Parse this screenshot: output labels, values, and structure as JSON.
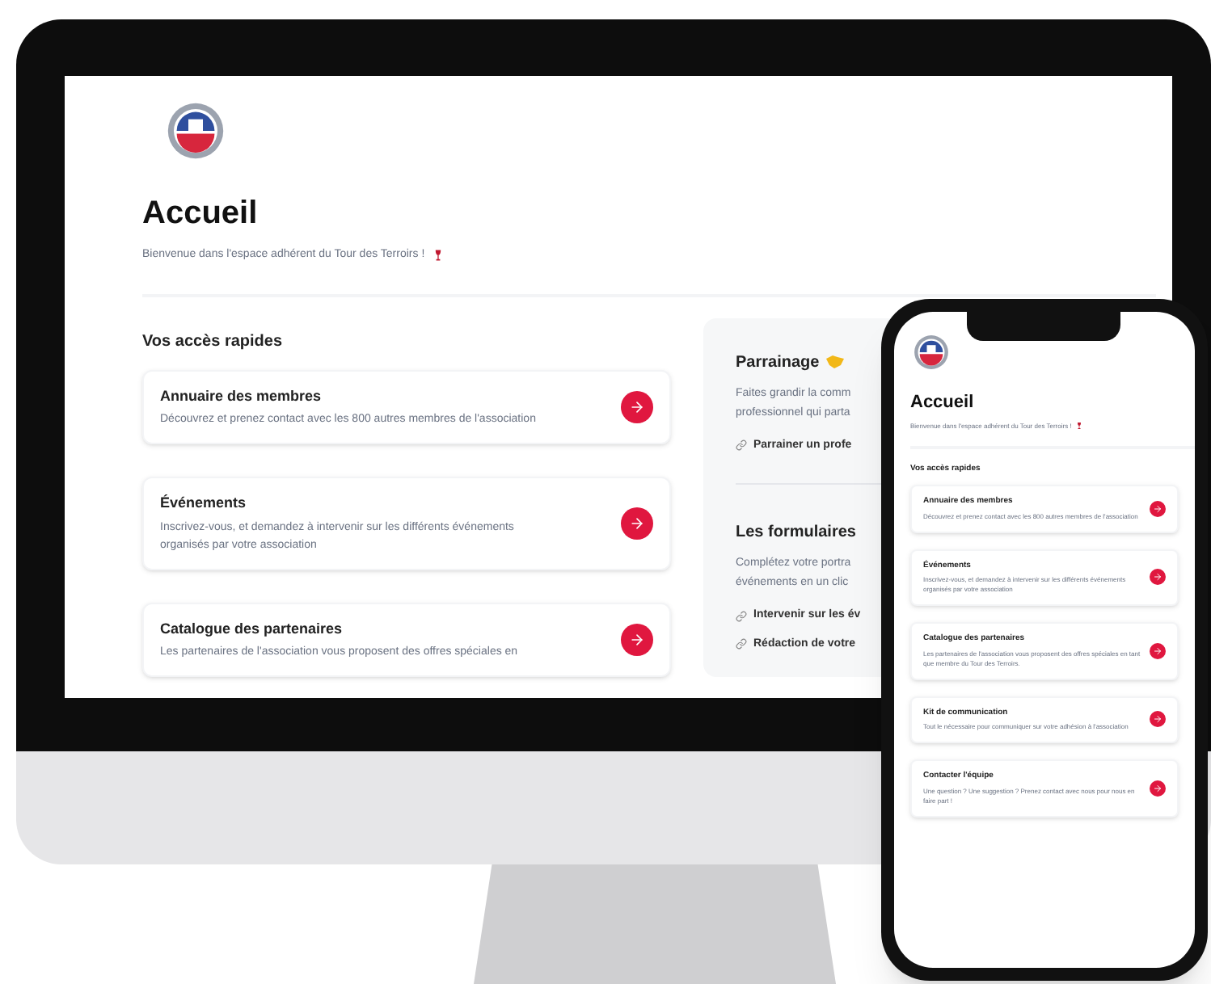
{
  "desktop": {
    "page": {
      "title": "Accueil",
      "subtitle": "Bienvenue dans l'espace adhérent du Tour des Terroirs !",
      "section_title": "Vos accès rapides",
      "cards": [
        {
          "title": "Annuaire des membres",
          "description": "Découvrez et prenez contact avec les 800 autres membres de l'association"
        },
        {
          "title": "Événements",
          "description": "Inscrivez-vous, et demandez à intervenir sur les différents événements organisés par votre association"
        },
        {
          "title": "Catalogue des partenaires",
          "description": "Les partenaires de l'association vous proposent des offres spéciales en"
        }
      ],
      "side_panel": [
        {
          "title": "Parrainage",
          "description": [
            "Faites grandir la comm",
            "professionnel qui parta"
          ],
          "links": [
            "Parrainer un profe"
          ]
        },
        {
          "title": "Les formulaires",
          "description": [
            "Complétez votre portra",
            "événements en un clic"
          ],
          "links": [
            "Intervenir sur les év",
            "Rédaction de votre"
          ]
        }
      ]
    }
  },
  "phone": {
    "page": {
      "title": "Accueil",
      "subtitle": "Bienvenue dans l'espace adhérent du Tour des Terroirs !",
      "section_title": "Vos accès rapides",
      "cards": [
        {
          "title": "Annuaire des membres",
          "description": "Découvrez et prenez contact avec les 800 autres membres de l'association"
        },
        {
          "title": "Événements",
          "description": "Inscrivez-vous, et demandez à intervenir sur les différents événements organisés par votre association"
        },
        {
          "title": "Catalogue des partenaires",
          "description": "Les partenaires de l'association vous proposent des offres spéciales en tant que membre du Tour des Terroirs."
        },
        {
          "title": "Kit de communication",
          "description": "Tout le nécessaire pour communiquer sur votre adhésion à l'association"
        },
        {
          "title": "Contacter l'équipe",
          "description": "Une question ? Une suggestion ? Prenez contact avec nous pour nous en faire part !"
        }
      ]
    }
  }
}
